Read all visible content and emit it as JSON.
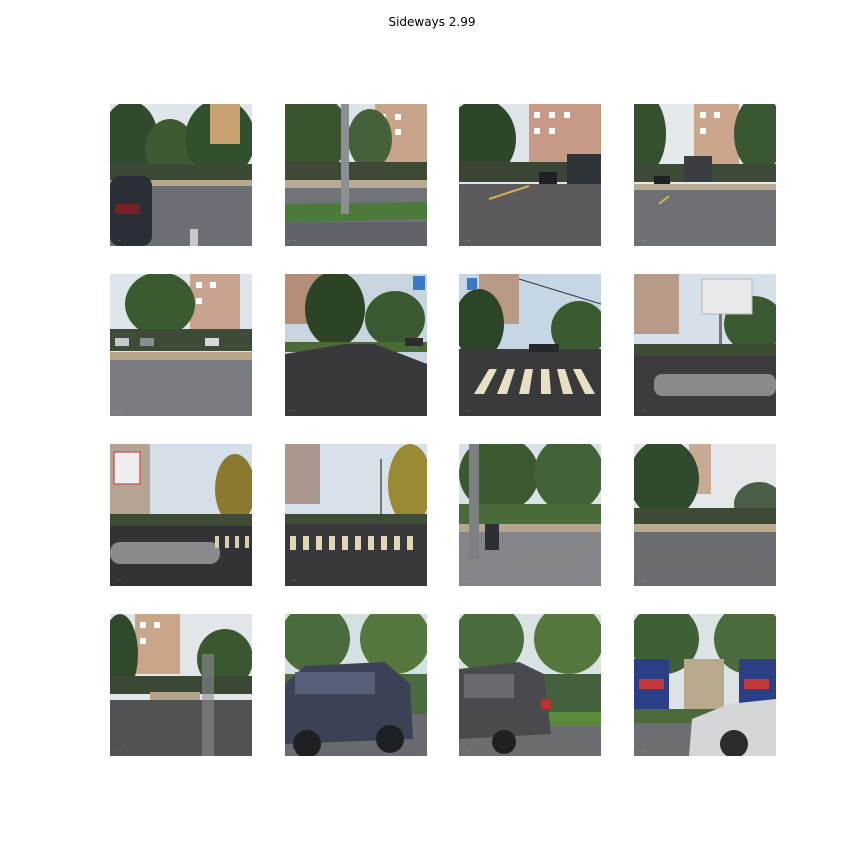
{
  "figure": {
    "title": "Sideways 2.99"
  },
  "grid": {
    "rows": 4,
    "columns": 4,
    "tiles": [
      {
        "scene": "parked-car-left-road"
      },
      {
        "scene": "pole-lawn-road"
      },
      {
        "scene": "road-bus-building"
      },
      {
        "scene": "bus-stop-road"
      },
      {
        "scene": "parking-lot-building"
      },
      {
        "scene": "street-shadow-trees"
      },
      {
        "scene": "crosswalk-avenue"
      },
      {
        "scene": "billboard-intersection"
      },
      {
        "scene": "billboard-road-curb"
      },
      {
        "scene": "crosswalk-street-lamps"
      },
      {
        "scene": "pole-sidewalk-trees"
      },
      {
        "scene": "tree-sidewalk"
      },
      {
        "scene": "building-sidewalk"
      },
      {
        "scene": "dark-suv-passing"
      },
      {
        "scene": "grey-car-passing"
      },
      {
        "scene": "white-car-billboards"
      }
    ]
  }
}
